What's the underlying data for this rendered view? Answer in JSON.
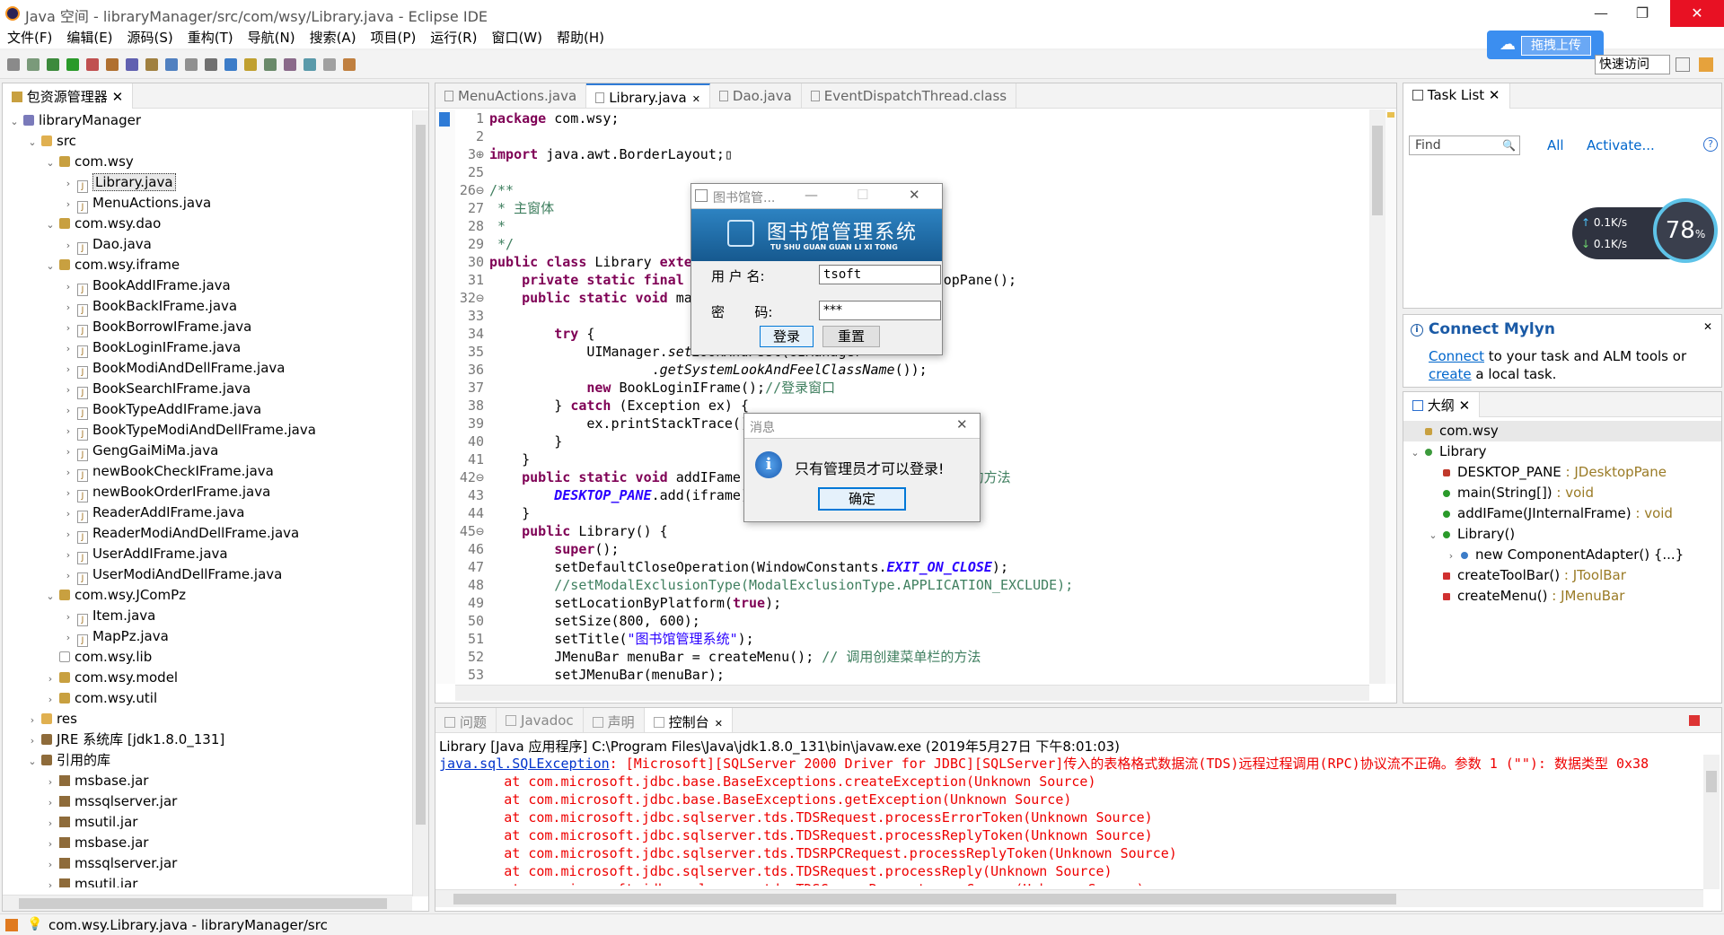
{
  "window": {
    "title": "Java 空间 - libraryManager/src/com/wsy/Library.java - Eclipse IDE"
  },
  "menu": [
    "文件(F)",
    "编辑(E)",
    "源码(S)",
    "重构(T)",
    "导航(N)",
    "搜索(A)",
    "项目(P)",
    "运行(R)",
    "窗口(W)",
    "帮助(H)"
  ],
  "upload_badge": "拖拽上传",
  "quick_access": "快速访问",
  "package_explorer": {
    "title": "包资源管理器",
    "items": [
      {
        "label": "libraryManager",
        "indent": 0,
        "kind": "project",
        "arrow": "v"
      },
      {
        "label": "src",
        "indent": 1,
        "kind": "folder",
        "arrow": "v"
      },
      {
        "label": "com.wsy",
        "indent": 2,
        "kind": "pkg",
        "arrow": "v"
      },
      {
        "label": "Library.java",
        "indent": 3,
        "kind": "java",
        "arrow": ">",
        "selected": true
      },
      {
        "label": "MenuActions.java",
        "indent": 3,
        "kind": "java",
        "arrow": ">"
      },
      {
        "label": "com.wsy.dao",
        "indent": 2,
        "kind": "pkg",
        "arrow": "v"
      },
      {
        "label": "Dao.java",
        "indent": 3,
        "kind": "java",
        "arrow": ">"
      },
      {
        "label": "com.wsy.iframe",
        "indent": 2,
        "kind": "pkg",
        "arrow": "v"
      },
      {
        "label": "BookAddIFrame.java",
        "indent": 3,
        "kind": "java",
        "arrow": ">"
      },
      {
        "label": "BookBackIFrame.java",
        "indent": 3,
        "kind": "java",
        "arrow": ">"
      },
      {
        "label": "BookBorrowIFrame.java",
        "indent": 3,
        "kind": "java",
        "arrow": ">"
      },
      {
        "label": "BookLoginIFrame.java",
        "indent": 3,
        "kind": "java",
        "arrow": ">"
      },
      {
        "label": "BookModiAndDellFrame.java",
        "indent": 3,
        "kind": "java",
        "arrow": ">"
      },
      {
        "label": "BookSearchIFrame.java",
        "indent": 3,
        "kind": "java",
        "arrow": ">"
      },
      {
        "label": "BookTypeAddIFrame.java",
        "indent": 3,
        "kind": "java",
        "arrow": ">"
      },
      {
        "label": "BookTypeModiAndDellFrame.java",
        "indent": 3,
        "kind": "java",
        "arrow": ">"
      },
      {
        "label": "GengGaiMiMa.java",
        "indent": 3,
        "kind": "java",
        "arrow": ">"
      },
      {
        "label": "newBookCheckIFrame.java",
        "indent": 3,
        "kind": "java",
        "arrow": ">"
      },
      {
        "label": "newBookOrderIFrame.java",
        "indent": 3,
        "kind": "java",
        "arrow": ">"
      },
      {
        "label": "ReaderAddIFrame.java",
        "indent": 3,
        "kind": "java",
        "arrow": ">"
      },
      {
        "label": "ReaderModiAndDellFrame.java",
        "indent": 3,
        "kind": "java",
        "arrow": ">"
      },
      {
        "label": "UserAddIFrame.java",
        "indent": 3,
        "kind": "java",
        "arrow": ">"
      },
      {
        "label": "UserModiAndDellFrame.java",
        "indent": 3,
        "kind": "java",
        "arrow": ">"
      },
      {
        "label": "com.wsy.JComPz",
        "indent": 2,
        "kind": "pkg",
        "arrow": "v"
      },
      {
        "label": "Item.java",
        "indent": 3,
        "kind": "java",
        "arrow": ">"
      },
      {
        "label": "MapPz.java",
        "indent": 3,
        "kind": "java",
        "arrow": ">"
      },
      {
        "label": "com.wsy.lib",
        "indent": 2,
        "kind": "pkg0",
        "arrow": ""
      },
      {
        "label": "com.wsy.model",
        "indent": 2,
        "kind": "pkg",
        "arrow": ">"
      },
      {
        "label": "com.wsy.util",
        "indent": 2,
        "kind": "pkg",
        "arrow": ">"
      },
      {
        "label": "res",
        "indent": 1,
        "kind": "folder",
        "arrow": ">"
      },
      {
        "label": "JRE 系统库 [jdk1.8.0_131]",
        "indent": 1,
        "kind": "lib",
        "arrow": ">"
      },
      {
        "label": "引用的库",
        "indent": 1,
        "kind": "lib",
        "arrow": "v"
      },
      {
        "label": "msbase.jar",
        "indent": 2,
        "kind": "jar",
        "arrow": ">"
      },
      {
        "label": "mssqlserver.jar",
        "indent": 2,
        "kind": "jar",
        "arrow": ">"
      },
      {
        "label": "msutil.jar",
        "indent": 2,
        "kind": "jar",
        "arrow": ">"
      },
      {
        "label": "msbase.jar",
        "indent": 2,
        "kind": "jar",
        "arrow": ">"
      },
      {
        "label": "mssqlserver.jar",
        "indent": 2,
        "kind": "jar",
        "arrow": ">"
      },
      {
        "label": "msutil.jar",
        "indent": 2,
        "kind": "jar",
        "arrow": ">"
      }
    ]
  },
  "editor": {
    "tabs": [
      "MenuActions.java",
      "Library.java",
      "Dao.java",
      "EventDispatchThread.class"
    ],
    "active_tab": 1,
    "lines": [
      {
        "n": "1",
        "h": "<span class='kw'>package</span> com.wsy;"
      },
      {
        "n": "2",
        "h": ""
      },
      {
        "n": "3⊕",
        "h": "<span class='kw'>import</span> java.awt.BorderLayout;▯"
      },
      {
        "n": "25",
        "h": ""
      },
      {
        "n": "26⊖",
        "h": "<span class='cm'>/**</span>"
      },
      {
        "n": "27",
        "h": "<span class='cm'> * 主窗体</span>"
      },
      {
        "n": "28",
        "h": "<span class='cm'> *</span>"
      },
      {
        "n": "29",
        "h": "<span class='cm'> */</span>"
      },
      {
        "n": "30",
        "h": "<span class='kw'>public class</span> Library <span class='kw'>exter</span>"
      },
      {
        "n": "31",
        "h": "    <span class='kw'>private static final</span> J                        JDesktopPane();"
      },
      {
        "n": "32⊖",
        "h": "    <span class='kw'>public static void</span> mai"
      },
      {
        "n": "33",
        "h": ""
      },
      {
        "n": "34",
        "h": "        <span class='kw'>try</span> {"
      },
      {
        "n": "35",
        "h": "            UIManager.<span class='it'>setLookAndFeel</span>(UIManager"
      },
      {
        "n": "36",
        "h": "                    .<span class='it'>getSystemLookAndFeelClassName</span>());"
      },
      {
        "n": "37",
        "h": "            <span class='kw'>new</span> BookLoginIFrame();<span class='cm'>//登录窗口</span>"
      },
      {
        "n": "38",
        "h": "        } <span class='kw'>catch</span> (Exception ex) {"
      },
      {
        "n": "39",
        "h": "            ex.printStackTrace()"
      },
      {
        "n": "40",
        "h": "        }"
      },
      {
        "n": "41",
        "h": "    }"
      },
      {
        "n": "42⊖",
        "h": "    <span class='kw'>public static void</span> addIFame(                   <span class='cm'>添加子窗体的方法</span>"
      },
      {
        "n": "43",
        "h": "        <span class='st it'><b>DESKTOP_PANE</b></span>.add(iframe)"
      },
      {
        "n": "44",
        "h": "    }"
      },
      {
        "n": "45⊖",
        "h": "    <span class='kw'>public</span> Library() {"
      },
      {
        "n": "46",
        "h": "        <span class='kw'>super</span>();"
      },
      {
        "n": "47",
        "h": "        setDefaultCloseOperation(WindowConstants.<span class='st it'><b>EXIT_ON_CLOSE</b></span>);"
      },
      {
        "n": "48",
        "h": "        <span class='cm'>//setModalExclusionType(ModalExclusionType.APPLICATION_EXCLUDE);</span>"
      },
      {
        "n": "49",
        "h": "        setLocationByPlatform(<span class='kw'>true</span>);"
      },
      {
        "n": "50",
        "h": "        setSize(800, 600);"
      },
      {
        "n": "51",
        "h": "        setTitle(<span class='st'>\"图书馆管理系统\"</span>);"
      },
      {
        "n": "52",
        "h": "        JMenuBar menuBar = createMenu(); <span class='cm'>// 调用创建菜单栏的方法</span>"
      },
      {
        "n": "53",
        "h": "        setJMenuBar(menuBar);"
      }
    ]
  },
  "login_dialog": {
    "title": "图书馆管...",
    "banner": "图书馆管理系统",
    "banner_sub": "TU SHU GUAN GUAN LI XI TONG",
    "user_label": "用 户 名:",
    "user_value": "tsoft",
    "pass_label": "密       码:",
    "pass_value": "***",
    "login_btn": "登录",
    "reset_btn": "重置"
  },
  "message_dialog": {
    "title": "消息",
    "text": "只有管理员才可以登录!",
    "ok": "确定"
  },
  "task_list": {
    "title": "Task List",
    "find_placeholder": "Find",
    "all": "All",
    "activate": "Activate..."
  },
  "net_widget": {
    "up": "0.1K/s",
    "down": "0.1K/s",
    "percent": "78",
    "unit": "%"
  },
  "mylyn": {
    "title": "Connect Mylyn",
    "connect": "Connect",
    "text1": " to your task and ALM tools or ",
    "create": "create",
    "text2": " a local task."
  },
  "outline": {
    "title": "大纲",
    "items": [
      {
        "label": "com.wsy",
        "indent": 0,
        "type": "",
        "arrow": "",
        "icon": "pkg"
      },
      {
        "label": "Library",
        "indent": 0,
        "type": "",
        "arrow": "v",
        "icon": "class"
      },
      {
        "label": "DESKTOP_PANE",
        "indent": 1,
        "type": " : JDesktopPane",
        "arrow": "",
        "icon": "field"
      },
      {
        "label": "main(String[])",
        "indent": 1,
        "type": " : void",
        "arrow": "",
        "icon": "pub"
      },
      {
        "label": "addIFame(JInternalFrame)",
        "indent": 1,
        "type": " : void",
        "arrow": "",
        "icon": "pub"
      },
      {
        "label": "Library()",
        "indent": 1,
        "type": "",
        "arrow": "v",
        "icon": "pub"
      },
      {
        "label": "new ComponentAdapter() {...}",
        "indent": 2,
        "type": "",
        "arrow": ">",
        "icon": "anon"
      },
      {
        "label": "createToolBar()",
        "indent": 1,
        "type": " : JToolBar",
        "arrow": "",
        "icon": "priv"
      },
      {
        "label": "createMenu()",
        "indent": 1,
        "type": " : JMenuBar",
        "arrow": "",
        "icon": "priv"
      }
    ]
  },
  "console": {
    "tabs": [
      "问题",
      "Javadoc",
      "声明",
      "控制台"
    ],
    "active_tab": 3,
    "header": "Library [Java 应用程序] C:\\Program Files\\Java\\jdk1.8.0_131\\bin\\javaw.exe  (2019年5月27日 下午8:01:03)",
    "exception_link": "java.sql.SQLException",
    "first_line_rest": ": [Microsoft][SQLServer 2000 Driver for JDBC][SQLServer]传入的表格格式数据流(TDS)远程过程调用(RPC)协议流不正确。参数 1 (\"\"): 数据类型 0x38",
    "stack": [
      "        at com.microsoft.jdbc.base.BaseExceptions.createException(Unknown Source)",
      "        at com.microsoft.jdbc.base.BaseExceptions.getException(Unknown Source)",
      "        at com.microsoft.jdbc.sqlserver.tds.TDSRequest.processErrorToken(Unknown Source)",
      "        at com.microsoft.jdbc.sqlserver.tds.TDSRequest.processReplyToken(Unknown Source)",
      "        at com.microsoft.jdbc.sqlserver.tds.TDSRPCRequest.processReplyToken(Unknown Source)",
      "        at com.microsoft.jdbc.sqlserver.tds.TDSRequest.processReply(Unknown Source)",
      "        at com.microsoft.jdbc.sqlserver.tds.TDSCursorRequest.openCursor(Unknown Source)"
    ]
  },
  "status_bar": {
    "text": "com.wsy.Library.java - libraryManager/src"
  },
  "colors": {
    "accent": "#0066cc",
    "banner": "#1a6aa8",
    "error": "#e00000"
  }
}
